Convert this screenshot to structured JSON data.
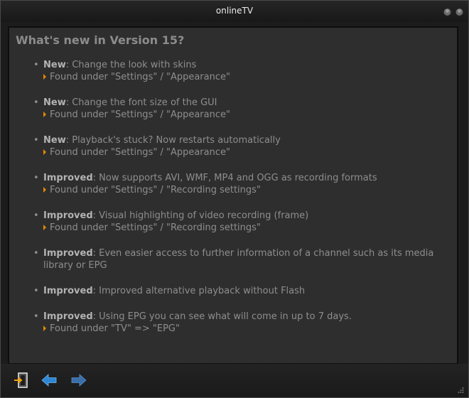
{
  "window": {
    "title": "onlineTV"
  },
  "content": {
    "heading": "What's new in Version 15?",
    "features": [
      {
        "tag": "New",
        "text": ": Change the look with skins",
        "sub": "Found under \"Settings\" / \"Appearance\""
      },
      {
        "tag": "New",
        "text": ": Change the font size of the GUI",
        "sub": "Found under \"Settings\" / \"Appearance\""
      },
      {
        "tag": "New",
        "text": ": Playback's stuck? Now restarts automatically",
        "sub": "Found under \"Settings\" / \"Appearance\""
      },
      {
        "tag": "Improved",
        "text": ": Now supports AVI, WMF, MP4 and OGG as recording formats",
        "sub": "Found under \"Settings\" / \"Recording settings\""
      },
      {
        "tag": "Improved",
        "text": ": Visual highlighting of video recording (frame)",
        "sub": "Found under \"Settings\" / \"Recording settings\""
      },
      {
        "tag": "Improved",
        "text": ": Even easier access to further information of a channel such as its media library or EPG",
        "sub": null
      },
      {
        "tag": "Improved",
        "text": ": Improved alternative playback without Flash",
        "sub": null
      },
      {
        "tag": "Improved",
        "text": ": Using EPG you can see what will come in up to 7 days.",
        "sub": "Found under \"TV\" => \"EPG\""
      }
    ]
  },
  "colors": {
    "accent": "#e08a00",
    "nav_arrow": "#2f86d6",
    "background": "#2e2e2e"
  },
  "toolbar": {
    "icons": [
      "exit-icon",
      "back-arrow-icon",
      "forward-arrow-icon"
    ]
  }
}
